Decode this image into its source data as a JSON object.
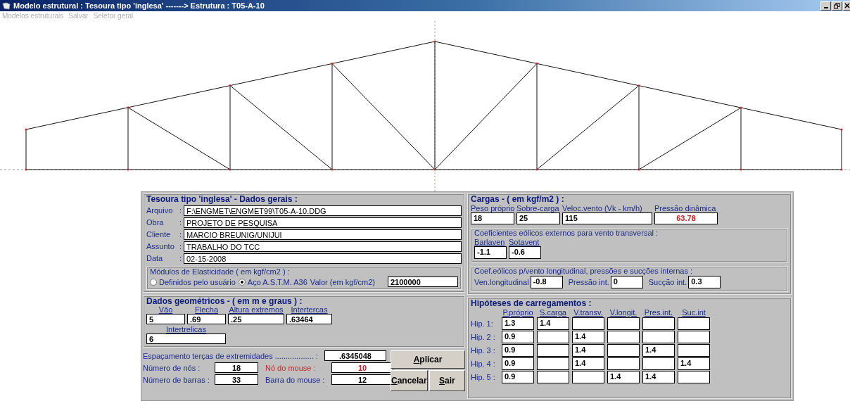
{
  "window": {
    "title": "Modelo estrutural : Tesoura tipo 'inglesa' -------> Estrutura : T05-A-10"
  },
  "menu": [
    {
      "label": "Modelos estruturais",
      "disabled": true
    },
    {
      "label": "Salvar",
      "disabled": true
    },
    {
      "label": "Seletor geral",
      "disabled": true
    }
  ],
  "general": {
    "title": "Tesoura tipo 'inglesa' - Dados gerais :",
    "fields": [
      {
        "label": "Arquivo",
        "colon": ":",
        "value": "F:\\ENGMET\\ENGMET99\\T05-A-10.DDG"
      },
      {
        "label": "Obra",
        "colon": ":",
        "value": "PROJETO DE PESQUISA"
      },
      {
        "label": "Cliente",
        "colon": ":",
        "value": "MARCIO BREUNIG/UNIJUI"
      },
      {
        "label": "Assunto",
        "colon": ":",
        "value": "TRABALHO DO TCC"
      },
      {
        "label": "Data",
        "colon": ":",
        "value": "02-15-2008"
      }
    ],
    "elasticity": {
      "title": "Módulos de Elasticidade    ( em kgf/cm2  ) :",
      "options": [
        {
          "label": "Definidos pelo usuário",
          "selected": false
        },
        {
          "label": "Aço A.S.T.M. A36",
          "selected": true
        }
      ],
      "value_label": "Valor (em kgf/cm2)",
      "value": "2100000"
    }
  },
  "geometry": {
    "title": "Dados geométricos  -  ( em m e graus ) :",
    "fields": [
      {
        "label": "Vão",
        "value": "5"
      },
      {
        "label": "Flecha",
        "value": ".69"
      },
      {
        "label": "Altura extremos",
        "value": ".25"
      },
      {
        "label": "Intertercas",
        "value": ".63464"
      },
      {
        "label": "Intertrelicas",
        "value": "6"
      }
    ],
    "spacing": {
      "label": "Espaçamento terças de extremidades .................. :",
      "value": ".6345048"
    },
    "stats": [
      {
        "label": "Número de nós     :",
        "value": "18",
        "kind": "plain"
      },
      {
        "label": "Nó do mouse       :",
        "value": "10",
        "kind": "alert"
      },
      {
        "label": "Número de barras :",
        "value": "33",
        "kind": "plain"
      },
      {
        "label": "Barra do mouse :",
        "value": "12",
        "kind": "info"
      }
    ]
  },
  "buttons": [
    {
      "label": "Aplicar",
      "underline_first": true
    },
    {
      "label": "Cancelar",
      "underline_first": true
    },
    {
      "label": "Sair",
      "underline_first": true
    }
  ],
  "loads": {
    "title": "Cargas   -  ( em kgf/m2 ) :",
    "fields": [
      {
        "label": "Peso próprio",
        "value": "18",
        "kind": "input"
      },
      {
        "label": "Sobre-carga",
        "value": "25",
        "kind": "input"
      },
      {
        "label": "Veloc.vento (Vk - km/h)",
        "value": "115",
        "kind": "input"
      },
      {
        "label": "Pressão dinâmica",
        "value": "63.78",
        "kind": "result"
      }
    ],
    "external": {
      "title": "Coeficientes eólicos externos para vento transversal :",
      "fields": [
        {
          "label": "Barlaven",
          "value": "-1.1"
        },
        {
          "label": "Sotavent",
          "value": "-0.6"
        }
      ]
    },
    "longitudinal": {
      "title": "Coef.eólicos p/vento longitudinal, pressões e sucções internas :",
      "fields": [
        {
          "label": "Ven.longitudinal",
          "value": "-0.8"
        },
        {
          "label": "Pressão int.",
          "value": "0"
        },
        {
          "label": "Sucção int.",
          "value": "0.3"
        }
      ]
    }
  },
  "hypotheses": {
    "title": "Hipóteses de carregamentos :",
    "columns": [
      "P.próprio",
      "S.carga",
      "V.transv.",
      "V.longit.",
      "Pres.int.",
      "Suc.int"
    ],
    "rows": [
      {
        "label": "Hip. 1:",
        "cells": [
          "1.3",
          "1.4",
          null,
          null,
          null,
          null
        ]
      },
      {
        "label": "Hip. 2 :",
        "cells": [
          "0.9",
          null,
          "1.4",
          null,
          null,
          null
        ]
      },
      {
        "label": "Hip. 3 :",
        "cells": [
          "0.9",
          null,
          "1.4",
          null,
          "1.4",
          null
        ]
      },
      {
        "label": "Hip. 4 :",
        "cells": [
          "0.9",
          null,
          "1.4",
          null,
          null,
          "1.4"
        ]
      },
      {
        "label": "Hip. 5 :",
        "cells": [
          "0.9",
          null,
          null,
          "1.4",
          "1.4",
          null
        ]
      }
    ]
  }
}
